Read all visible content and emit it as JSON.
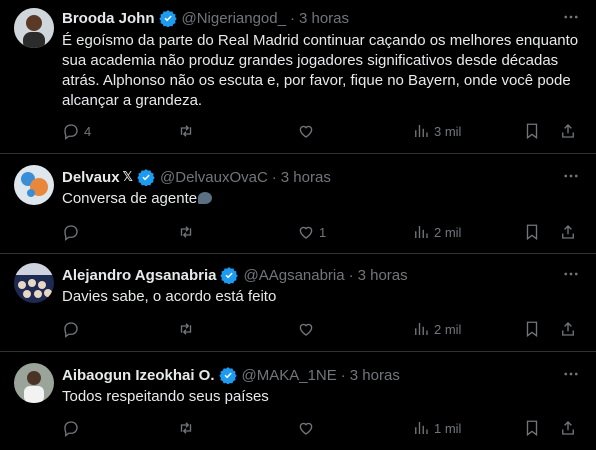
{
  "tweets": [
    {
      "name": "Brooda John",
      "handle": "@Nigeriangod_",
      "time": "3 horas",
      "text": "É egoísmo da parte do Real Madrid continuar caçando os melhores enquanto sua academia não produz grandes jogadores significativos desde décadas atrás. Alphonso não os escuta e, por favor, fique no Bayern, onde você pode alcançar a grandeza.",
      "replies": "4",
      "retweets": "",
      "likes": "",
      "views": "3 mil"
    },
    {
      "name": "Delvaux",
      "handle": "@DelvauxOvaC",
      "time": "3 horas",
      "text": "Conversa de agente",
      "replies": "",
      "retweets": "",
      "likes": "1",
      "views": "2 mil"
    },
    {
      "name": "Alejandro Agsanabria",
      "handle": "@AAgsanabria",
      "time": "3 horas",
      "text": "Davies sabe, o acordo está feito",
      "replies": "",
      "retweets": "",
      "likes": "",
      "views": "2 mil"
    },
    {
      "name": "Aibaogun Izeokhai O.",
      "handle": "@MAKA_1NE",
      "time": "3 horas",
      "text": "Todos respeitando seus países",
      "replies": "",
      "retweets": "",
      "likes": "",
      "views": "1 mil"
    }
  ],
  "separator": "·",
  "colors": {
    "background": "#000000",
    "text": "#e7e9ea",
    "muted": "#71767b",
    "verified": "#1d9bf0",
    "border": "#2f3336"
  }
}
